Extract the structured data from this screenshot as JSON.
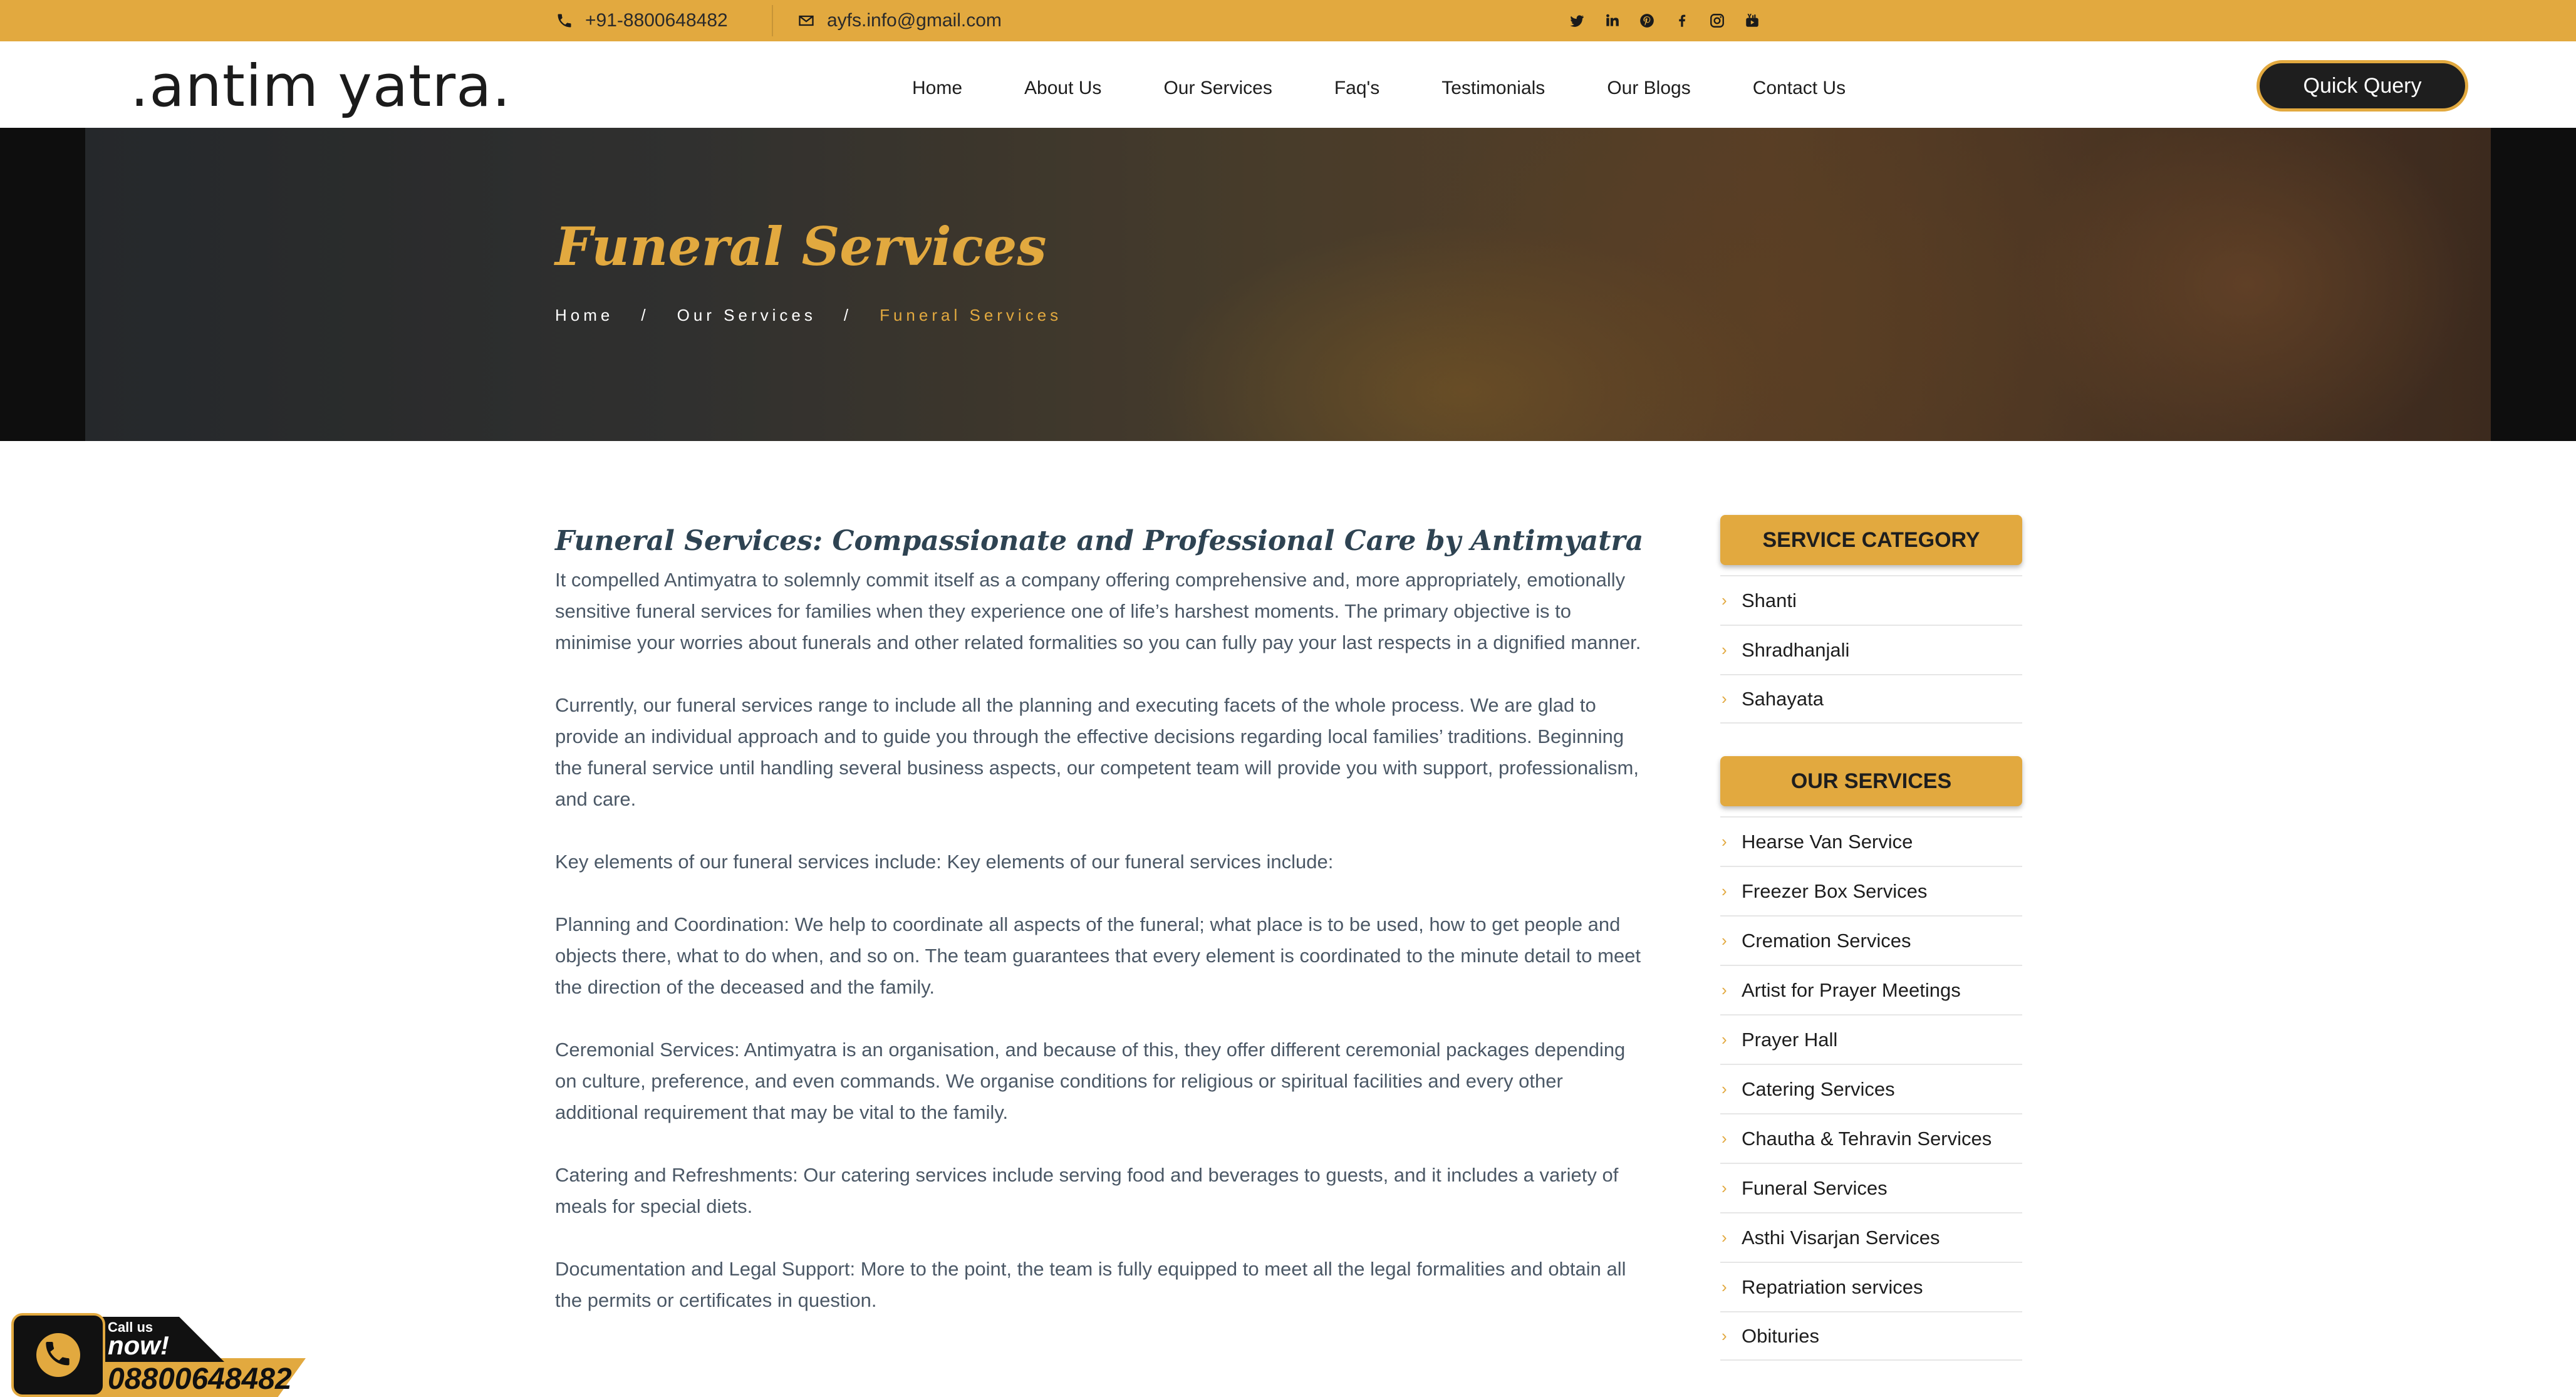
{
  "topbar": {
    "phone": "+91-8800648482",
    "email": "ayfs.info@gmail.com",
    "socials": [
      "twitter-icon",
      "linkedin-icon",
      "pinterest-icon",
      "facebook-icon",
      "instagram-icon",
      "youtube-icon"
    ]
  },
  "header": {
    "logo": ".antim yatra.",
    "nav": [
      "Home",
      "About Us",
      "Our Services",
      "Faq's",
      "Testimonials",
      "Our Blogs",
      "Contact Us"
    ],
    "quick_query": "Quick Query"
  },
  "banner": {
    "title": "Funeral Services",
    "breadcrumb": [
      "Home",
      "/",
      "Our Services",
      "/",
      "Funeral Services"
    ]
  },
  "main": {
    "heading": "Funeral Services: Compassionate and Professional Care by Antimyatra",
    "paragraphs": [
      "It compelled Antimyatra to solemnly commit itself as a company offering comprehensive and, more appropriately, emotionally sensitive funeral services for families when they experience one of life’s harshest moments. The primary objective is to minimise your worries about funerals and other related formalities so you can fully pay your last respects in a dignified manner.",
      "Currently, our funeral services range to include all the planning and executing facets of the whole process. We are glad to provide an individual approach and to guide you through the effective decisions regarding local families’ traditions. Beginning the funeral service until handling several business aspects, our competent team will provide you with support, professionalism, and care.",
      "Key elements of our funeral services include: Key elements of our funeral services include:",
      "Planning and Coordination: We help to coordinate all aspects of the funeral; what place is to be used, how to get people and objects there, what to do when, and so on. The team guarantees that every element is coordinated to the minute detail to meet the direction of the deceased and the family.",
      "Ceremonial Services: Antimyatra is an organisation, and because of this, they offer different ceremonial packages depending on culture, preference, and even commands. We organise conditions for religious or spiritual facilities and every other additional requirement that may be vital to the family.",
      "Catering and Refreshments: Our catering services include serving food and beverages to guests, and it includes a variety of meals for special diets.",
      "Documentation and Legal Support: More to the point, the team is fully equipped to meet all the legal formalities and obtain all the permits or certificates in question."
    ]
  },
  "sidebar": {
    "category_title": "SERVICE CATEGORY",
    "categories": [
      "Shanti",
      "Shradhanjali",
      "Sahayata"
    ],
    "services_title": "OUR SERVICES",
    "services": [
      "Hearse Van Service",
      "Freezer Box Services",
      "Cremation Services",
      "Artist for Prayer Meetings",
      "Prayer Hall",
      "Catering Services",
      "Chautha & Tehravin Services",
      "Funeral Services",
      "Asthi Visarjan Services",
      "Repatriation services",
      "Obituries"
    ]
  },
  "call_badge": {
    "call_us": "Call us",
    "now": "now!",
    "number": "08800648482"
  },
  "colors": {
    "accent": "#e2a93f",
    "dark": "#1e1e1e",
    "heading": "#2e4352",
    "body_text": "#4b5866"
  }
}
